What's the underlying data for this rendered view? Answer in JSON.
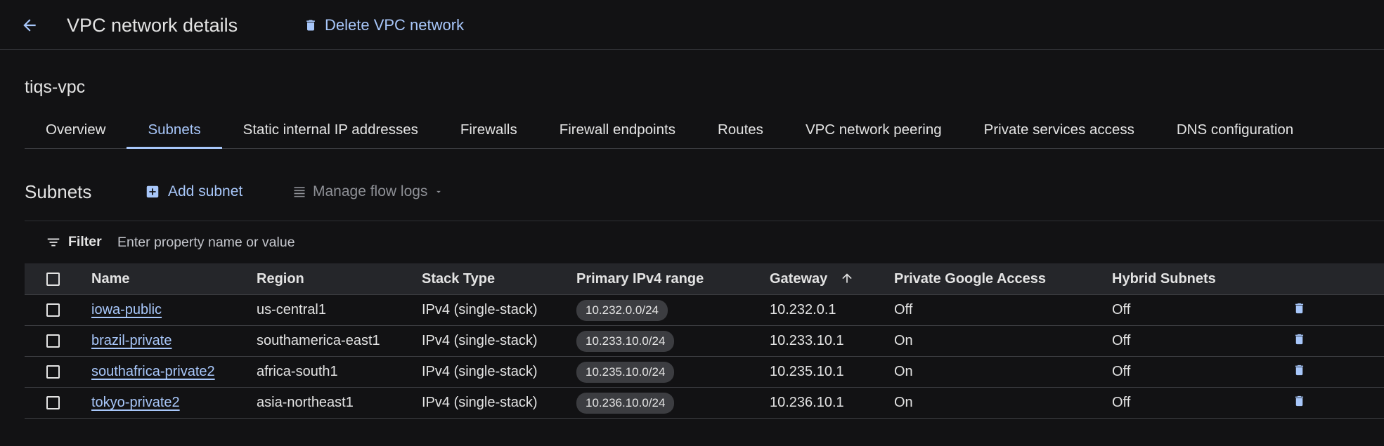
{
  "header": {
    "title": "VPC network details",
    "delete_label": "Delete VPC network"
  },
  "network": {
    "name": "tiqs-vpc"
  },
  "tabs": [
    {
      "label": "Overview",
      "active": false
    },
    {
      "label": "Subnets",
      "active": true
    },
    {
      "label": "Static internal IP addresses",
      "active": false
    },
    {
      "label": "Firewalls",
      "active": false
    },
    {
      "label": "Firewall endpoints",
      "active": false
    },
    {
      "label": "Routes",
      "active": false
    },
    {
      "label": "VPC network peering",
      "active": false
    },
    {
      "label": "Private services access",
      "active": false
    },
    {
      "label": "DNS configuration",
      "active": false
    }
  ],
  "subnets_section": {
    "title": "Subnets",
    "add_label": "Add subnet",
    "flow_logs_label": "Manage flow logs"
  },
  "filter": {
    "label": "Filter",
    "placeholder": "Enter property name or value"
  },
  "table": {
    "columns": [
      "Name",
      "Region",
      "Stack Type",
      "Primary IPv4 range",
      "Gateway",
      "Private Google Access",
      "Hybrid Subnets"
    ],
    "sorted_column": "Gateway",
    "rows": [
      {
        "name": "iowa-public",
        "region": "us-central1",
        "stack": "IPv4 (single-stack)",
        "range": "10.232.0.0/24",
        "gateway": "10.232.0.1",
        "pga": "Off",
        "hybrid": "Off"
      },
      {
        "name": "brazil-private",
        "region": "southamerica-east1",
        "stack": "IPv4 (single-stack)",
        "range": "10.233.10.0/24",
        "gateway": "10.233.10.1",
        "pga": "On",
        "hybrid": "Off"
      },
      {
        "name": "southafrica-private2",
        "region": "africa-south1",
        "stack": "IPv4 (single-stack)",
        "range": "10.235.10.0/24",
        "gateway": "10.235.10.1",
        "pga": "On",
        "hybrid": "Off"
      },
      {
        "name": "tokyo-private2",
        "region": "asia-northeast1",
        "stack": "IPv4 (single-stack)",
        "range": "10.236.10.0/24",
        "gateway": "10.236.10.1",
        "pga": "On",
        "hybrid": "Off"
      }
    ]
  },
  "colors": {
    "background": "#121214",
    "accent": "#a8c7fa",
    "header_row": "#25262a",
    "chip": "#3c3d41"
  },
  "icons": {
    "back": "arrow-left-icon",
    "delete": "trash-icon",
    "add": "add-box-icon",
    "flow_logs": "list-icon",
    "filter": "filter-icon",
    "sort": "arrow-up-icon",
    "row_delete": "trash-icon"
  }
}
